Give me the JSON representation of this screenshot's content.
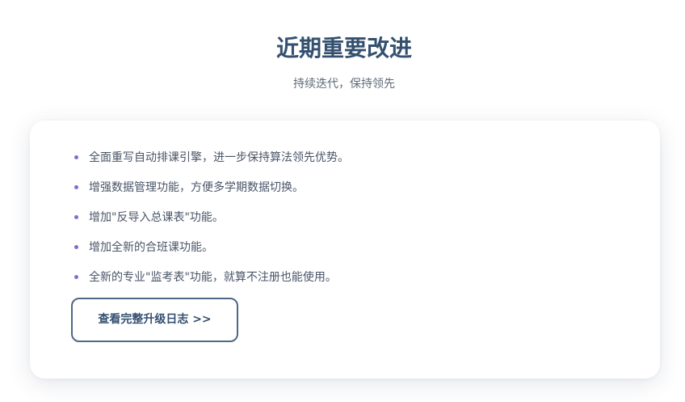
{
  "header": {
    "title": "近期重要改进",
    "subtitle": "持续迭代，保持领先"
  },
  "card": {
    "items": [
      "全面重写自动排课引擎，进一步保持算法领先优势。",
      "增强数据管理功能，方便多学期数据切换。",
      "增加\"反导入总课表\"功能。",
      "增加全新的合班课功能。",
      "全新的专业\"监考表\"功能，就算不注册也能使用。"
    ],
    "button_label": "查看完整升级日志 >>"
  },
  "colors": {
    "title": "#34506f",
    "bullet": "#7b6fd6",
    "button_border": "#4f6886"
  }
}
